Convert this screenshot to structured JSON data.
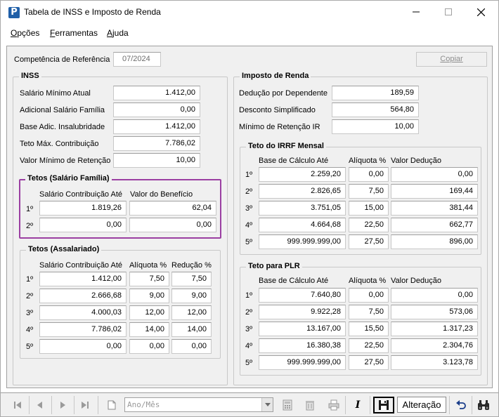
{
  "window": {
    "title": "Tabela de INSS e Imposto de Renda",
    "app_icon_letter": "P"
  },
  "menu": {
    "opcoes": {
      "u": "O",
      "rest": "pções"
    },
    "ferramentas": {
      "u": "F",
      "rest": "erramentas"
    },
    "ajuda": {
      "u": "A",
      "rest": "juda"
    }
  },
  "header": {
    "competencia_label": "Competência de Referência",
    "competencia_value": "07/2024",
    "copiar_label": "Copiar"
  },
  "inss": {
    "title": "INSS",
    "rows": [
      {
        "label": "Salário Mínimo Atual",
        "value": "1.412,00"
      },
      {
        "label": "Adicional Salário Família",
        "value": "0,00"
      },
      {
        "label": "Base Adic. Insalubridade",
        "value": "1.412,00"
      },
      {
        "label": "Teto Máx. Contribuição",
        "value": "7.786,02"
      },
      {
        "label": "Valor Mínimo de Retenção",
        "value": "10,00"
      }
    ]
  },
  "tetos_familia": {
    "title": "Tetos (Salário Família)",
    "headers": [
      "Salário Contribuição Até",
      "Valor do Benefício"
    ],
    "rows": [
      {
        "ord": "1º",
        "a": "1.819,26",
        "b": "62,04"
      },
      {
        "ord": "2º",
        "a": "0,00",
        "b": "0,00"
      }
    ]
  },
  "tetos_assalariado": {
    "title": "Tetos (Assalariado)",
    "headers": [
      "Salário Contribuição Até",
      "Alíquota %",
      "Redução %"
    ],
    "rows": [
      {
        "ord": "1º",
        "a": "1.412,00",
        "b": "7,50",
        "c": "7,50"
      },
      {
        "ord": "2º",
        "a": "2.666,68",
        "b": "9,00",
        "c": "9,00"
      },
      {
        "ord": "3º",
        "a": "4.000,03",
        "b": "12,00",
        "c": "12,00"
      },
      {
        "ord": "4º",
        "a": "7.786,02",
        "b": "14,00",
        "c": "14,00"
      },
      {
        "ord": "5º",
        "a": "0,00",
        "b": "0,00",
        "c": "0,00"
      }
    ]
  },
  "imposto_renda": {
    "title": "Imposto de Renda",
    "rows": [
      {
        "label": "Dedução por Dependente",
        "value": "189,59"
      },
      {
        "label": "Desconto Simplificado",
        "value": "564,80"
      },
      {
        "label": "Mínimo de Retenção IR",
        "value": "10,00"
      }
    ]
  },
  "irrf_mensal": {
    "title": "Teto do IRRF Mensal",
    "headers": [
      "Base de Cálculo Até",
      "Alíquota %",
      "Valor Dedução"
    ],
    "rows": [
      {
        "ord": "1º",
        "a": "2.259,20",
        "b": "0,00",
        "c": "0,00"
      },
      {
        "ord": "2º",
        "a": "2.826,65",
        "b": "7,50",
        "c": "169,44"
      },
      {
        "ord": "3º",
        "a": "3.751,05",
        "b": "15,00",
        "c": "381,44"
      },
      {
        "ord": "4º",
        "a": "4.664,68",
        "b": "22,50",
        "c": "662,77"
      },
      {
        "ord": "5º",
        "a": "999.999.999,00",
        "b": "27,50",
        "c": "896,00"
      }
    ]
  },
  "teto_plr": {
    "title": "Teto para PLR",
    "headers": [
      "Base de Cálculo Até",
      "Alíquota %",
      "Valor Dedução"
    ],
    "rows": [
      {
        "ord": "1º",
        "a": "7.640,80",
        "b": "0,00",
        "c": "0,00"
      },
      {
        "ord": "2º",
        "a": "9.922,28",
        "b": "7,50",
        "c": "573,06"
      },
      {
        "ord": "3º",
        "a": "13.167,00",
        "b": "15,50",
        "c": "1.317,23"
      },
      {
        "ord": "4º",
        "a": "16.380,38",
        "b": "22,50",
        "c": "2.304,76"
      },
      {
        "ord": "5º",
        "a": "999.999.999,00",
        "b": "27,50",
        "c": "3.123,78"
      }
    ]
  },
  "toolbar": {
    "period_placeholder": "Ano/Mês",
    "mode_text": "Alteração",
    "italic_label": "I"
  },
  "colors": {
    "highlight_border": "#9b3fa2",
    "panel_bg": "#f0f0f0"
  }
}
